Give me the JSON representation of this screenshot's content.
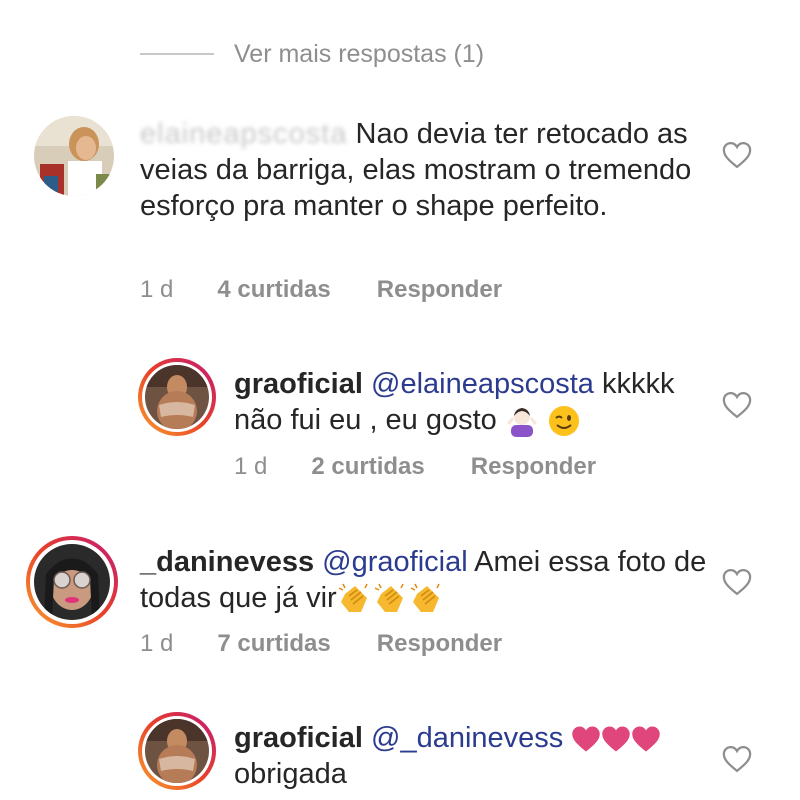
{
  "view_more": {
    "label": "Ver mais respostas (1)"
  },
  "comments": [
    {
      "username": "elaineapscosta",
      "text": "Nao devia ter retocado as veias da barriga, elas mostram o tremendo esforço pra manter o shape perfeito.",
      "time": "1 d",
      "likes": "4 curtidas",
      "reply_label": "Responder"
    },
    {
      "username": "graoficial",
      "mention": "@elaineapscosta",
      "text": "kkkkk não fui eu , eu gosto",
      "emojis": [
        "woman-shrugging",
        "winking-face"
      ],
      "time": "1 d",
      "likes": "2 curtidas",
      "reply_label": "Responder"
    },
    {
      "username": "_daninevess",
      "mention": "@graoficial",
      "text": "Amei essa foto de todas  que já vir",
      "emojis": [
        "clapping-hands",
        "clapping-hands",
        "clapping-hands"
      ],
      "time": "1 d",
      "likes": "7 curtidas",
      "reply_label": "Responder"
    },
    {
      "username": "graoficial",
      "mention": "@_daninevess",
      "emojis": [
        "pink-heart",
        "pink-heart",
        "pink-heart"
      ],
      "text": "obrigada"
    }
  ],
  "colors": {
    "mention": "#2b3b8f",
    "meta": "#8e8e8e",
    "story_ring_start": "#f9a12e",
    "story_ring_end": "#c21975",
    "heart_emoji": "#e0457b"
  }
}
